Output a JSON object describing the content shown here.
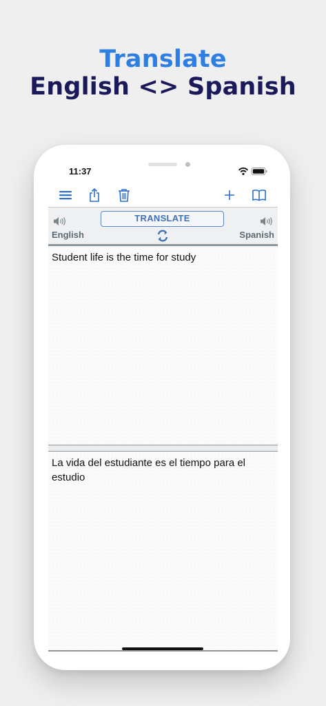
{
  "headline": {
    "line1": "Translate",
    "line2": "English <> Spanish"
  },
  "status_bar": {
    "time": "11:37",
    "icons": [
      "wifi-icon",
      "battery-icon"
    ]
  },
  "toolbar": {
    "left_items": [
      "menu-icon",
      "share-icon",
      "trash-icon"
    ],
    "right_items": [
      "add-icon",
      "book-icon"
    ]
  },
  "language_bar": {
    "translate_label": "TRANSLATE",
    "source_language": "English",
    "target_language": "Spanish",
    "swap_icon": "swap-icon",
    "speaker_icon": "speaker-icon"
  },
  "source_pane": {
    "text": "Student life is the time for study"
  },
  "target_pane": {
    "text": "La vida del estudiante es el tiempo para el estudio"
  },
  "colors": {
    "headline_accent": "#2f7fe3",
    "headline_dark": "#1a1a5a",
    "toolbar_icon": "#2d6fc9",
    "translate_button": "#3f6fb6"
  }
}
